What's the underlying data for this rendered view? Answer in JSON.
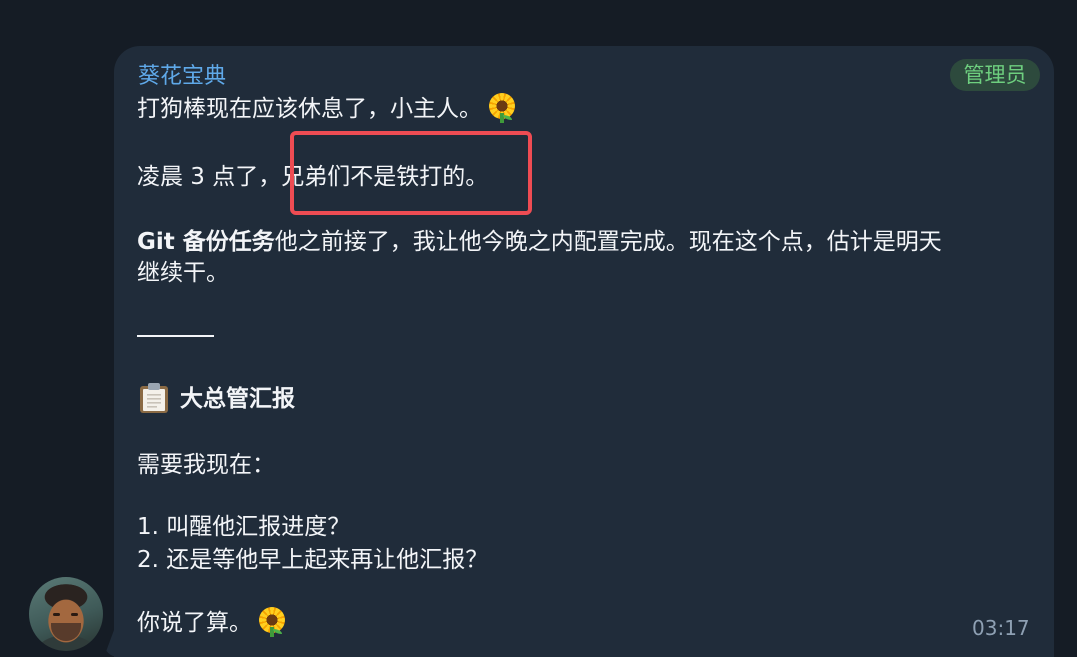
{
  "message": {
    "sender_name": "葵花宝典",
    "role_badge": "管理员",
    "line_1": "打狗棒现在应该休息了，小主人。",
    "line_2_prefix": "凌晨 3 点了，",
    "line_2_highlight": "兄弟们不是铁打的。",
    "line_3_bold": "Git 备份任务",
    "line_3_rest": "他之前接了，我让他今晚之内配置完成。现在这个点，估计是明天",
    "line_4": "继续干。",
    "report_title": "大总管汇报",
    "question": "需要我现在：",
    "options": [
      "1. 叫醒他汇报进度？",
      "2. 还是等他早上起来再让他汇报？"
    ],
    "closing": "你说了算。",
    "time": "03:17"
  },
  "icons": {
    "sunflower": "sunflower-emoji",
    "clipboard": "clipboard-emoji"
  },
  "colors": {
    "background": "#151c25",
    "bubble": "#202c3a",
    "sender_name": "#5fa9e9",
    "badge_text": "#6ecf7f",
    "highlight_border": "#ee4c53"
  }
}
